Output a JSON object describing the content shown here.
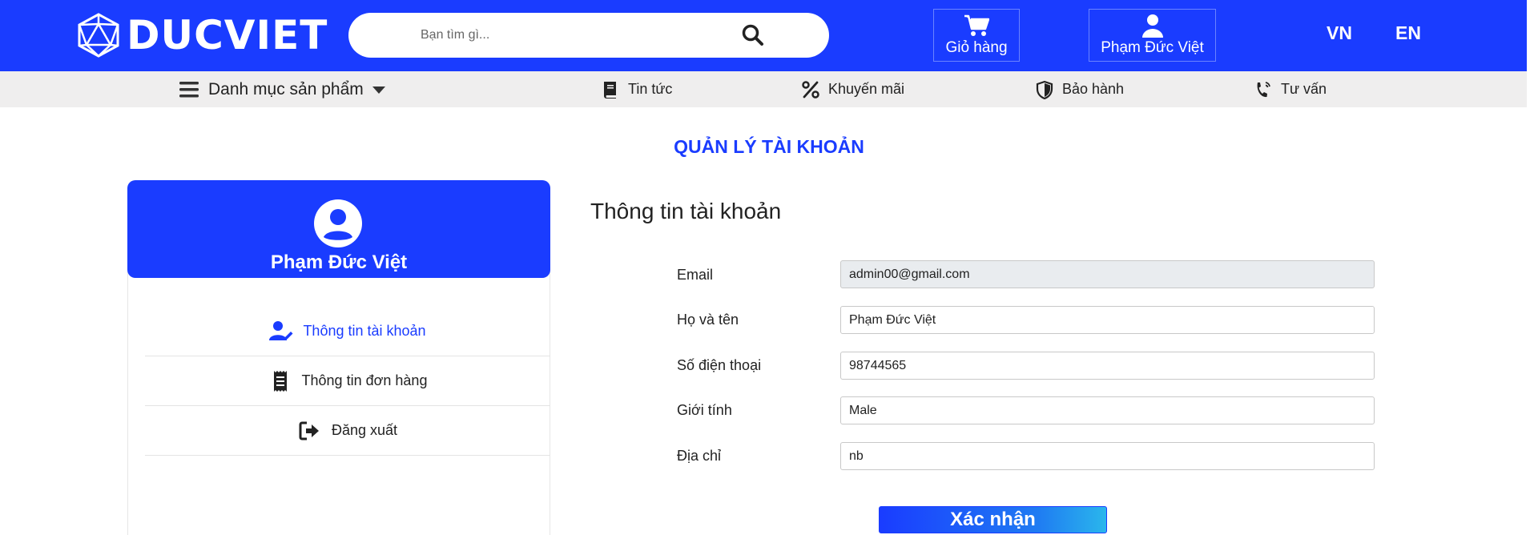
{
  "header": {
    "logo_text": "DUCVIET",
    "search_placeholder": "Bạn tìm gì...",
    "cart_label": "Giỏ hàng",
    "user_label": "Phạm Đức Việt",
    "lang_vn": "VN",
    "lang_en": "EN",
    "brand_color": "#1a3cff"
  },
  "nav": {
    "category_label": "Danh mục sản phẩm",
    "items": [
      {
        "label": "Tin tức",
        "icon": "book-icon"
      },
      {
        "label": "Khuyến mãi",
        "icon": "percent-icon"
      },
      {
        "label": "Bảo hành",
        "icon": "shield-icon"
      },
      {
        "label": "Tư vấn",
        "icon": "phone-icon"
      }
    ]
  },
  "page": {
    "title": "QUẢN LÝ TÀI KHOẢN"
  },
  "sidebar": {
    "user_name": "Phạm Đức Việt",
    "items": [
      {
        "label": "Thông tin tài khoản",
        "icon": "user-edit-icon",
        "active": true
      },
      {
        "label": "Thông tin đơn hàng",
        "icon": "receipt-icon",
        "active": false
      },
      {
        "label": "Đăng xuất",
        "icon": "sign-out-icon",
        "active": false
      }
    ]
  },
  "form": {
    "title": "Thông tin tài khoản",
    "fields": [
      {
        "label": "Email",
        "value": "admin00@gmail.com",
        "readonly": true
      },
      {
        "label": "Họ và tên",
        "value": "Phạm Đức Việt"
      },
      {
        "label": "Số điện thoại",
        "value": "98744565"
      },
      {
        "label": "Giới tính",
        "value": "Male"
      },
      {
        "label": "Địa chỉ",
        "value": "nb"
      }
    ],
    "submit_label": "Xác nhận"
  }
}
